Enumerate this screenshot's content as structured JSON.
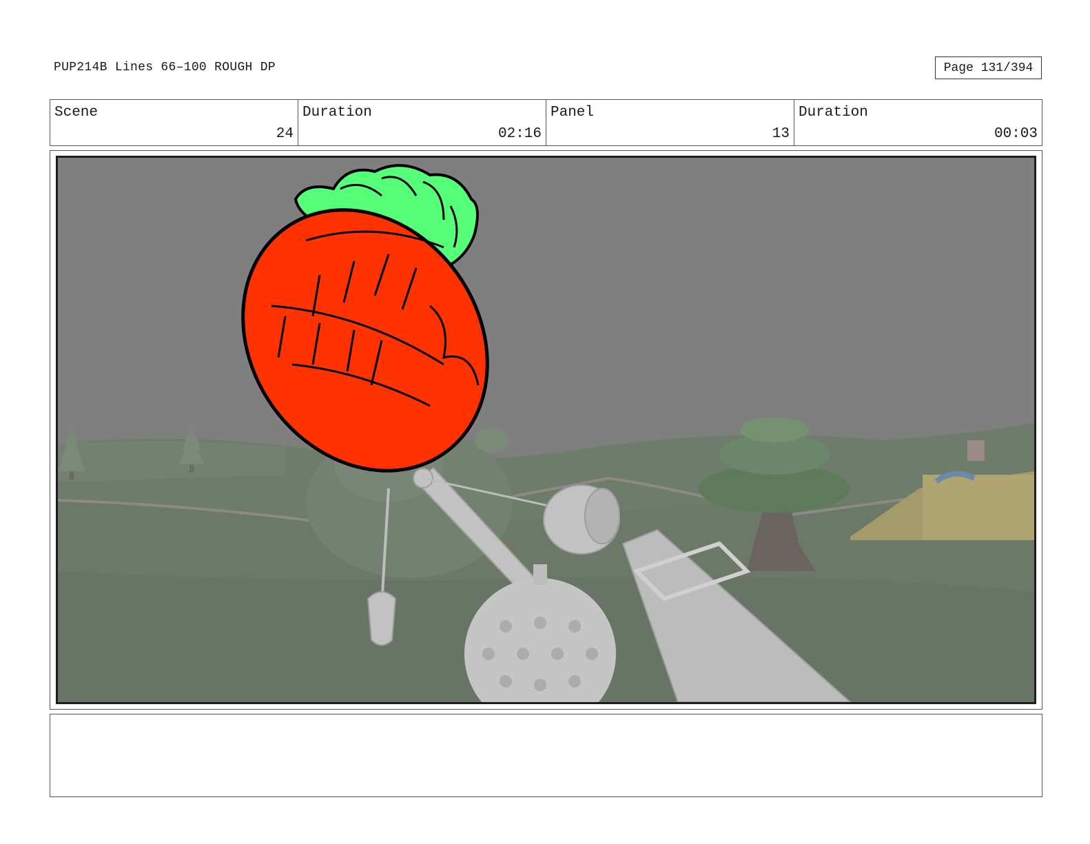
{
  "header": {
    "title": "PUP214B Lines 66–100 ROUGH DP",
    "page": "Page 131/394"
  },
  "info": {
    "scene_label": "Scene",
    "scene_value": "24",
    "scene_duration_label": "Duration",
    "scene_duration_value": "02:16",
    "panel_label": "Panel",
    "panel_value": "13",
    "panel_duration_label": "Duration",
    "panel_duration_value": "00:03"
  },
  "notes": {
    "text": ""
  },
  "colors": {
    "ball_red": "#ff3300",
    "leaf_green": "#55ff77",
    "sky_gray": "#7d7d7d",
    "ground_green": "#6f7e6c"
  }
}
